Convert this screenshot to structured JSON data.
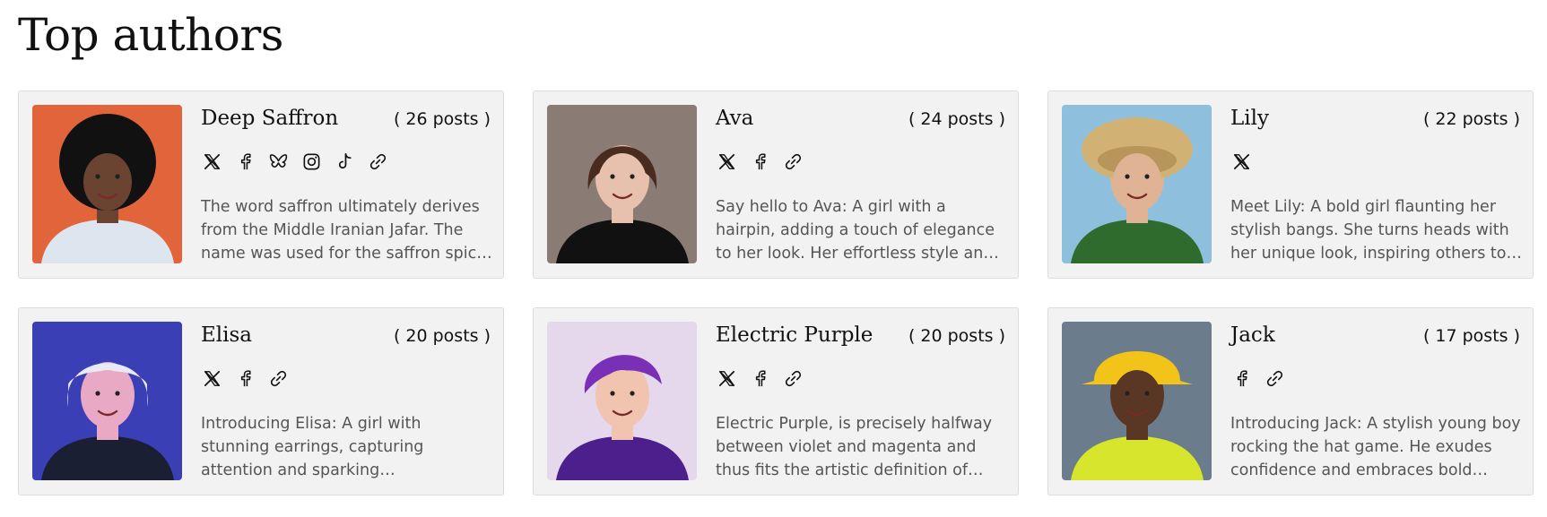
{
  "page": {
    "title": "Top authors"
  },
  "authors": [
    {
      "name": "Deep Saffron",
      "posts": "( 26 posts )",
      "socials": [
        "x-icon",
        "facebook-icon",
        "bluesky-icon",
        "instagram-icon",
        "tiktok-icon",
        "link-icon"
      ],
      "bio": "The word saffron ultimately derives from the Middle Iranian Jafar. The name was used for the saffron spice in Europe and later adopted for the color.",
      "colors": {
        "bg": "#e2643a",
        "skin": "#6b4331",
        "hair": "#111111",
        "shirt": "#dde6ee"
      }
    },
    {
      "name": "Ava",
      "posts": "( 24 posts )",
      "socials": [
        "x-icon",
        "facebook-icon",
        "link-icon"
      ],
      "bio": "Say hello to Ava: A girl with a hairpin, adding a touch of elegance to her look. Her effortless style and grace never go unnoticed.",
      "colors": {
        "bg": "#8a7b74",
        "skin": "#e7c1ad",
        "hair": "#4a2b1f",
        "shirt": "#111111"
      }
    },
    {
      "name": "Lily",
      "posts": "( 22 posts )",
      "socials": [
        "x-icon"
      ],
      "bio": "Meet Lily: A bold girl flaunting her stylish bangs. She turns heads with her unique look, inspiring others to follow.",
      "colors": {
        "bg": "#8ec0de",
        "skin": "#e0b394",
        "hair": "#d2b274",
        "shirt": "#2e6b2c"
      }
    },
    {
      "name": "Elisa",
      "posts": "( 20 posts )",
      "socials": [
        "x-icon",
        "facebook-icon",
        "link-icon"
      ],
      "bio": "Introducing Elisa: A girl with stunning earrings, capturing attention and sparking conversations. Her style is unforgettable.",
      "colors": {
        "bg": "#3a3fb5",
        "skin": "#e9a9c4",
        "hair": "#e7e9f5",
        "shirt": "#1b1f34"
      }
    },
    {
      "name": "Electric Purple",
      "posts": "( 20 posts )",
      "socials": [
        "x-icon",
        "facebook-icon",
        "link-icon"
      ],
      "bio": "Electric Purple, is precisely halfway between violet and magenta and thus fits the artistic definition of purple.",
      "colors": {
        "bg": "#e6d8ec",
        "skin": "#f0c4ae",
        "hair": "#7a2fb7",
        "shirt": "#4b1f8c"
      }
    },
    {
      "name": "Jack",
      "posts": "( 17 posts )",
      "socials": [
        "facebook-icon",
        "link-icon"
      ],
      "bio": "Introducing Jack: A stylish young boy rocking the hat game. He exudes confidence and embraces bold fashion.",
      "colors": {
        "bg": "#6b7d8c",
        "skin": "#5a3624",
        "hair": "#f2c318",
        "shirt": "#d7e62d"
      }
    }
  ]
}
